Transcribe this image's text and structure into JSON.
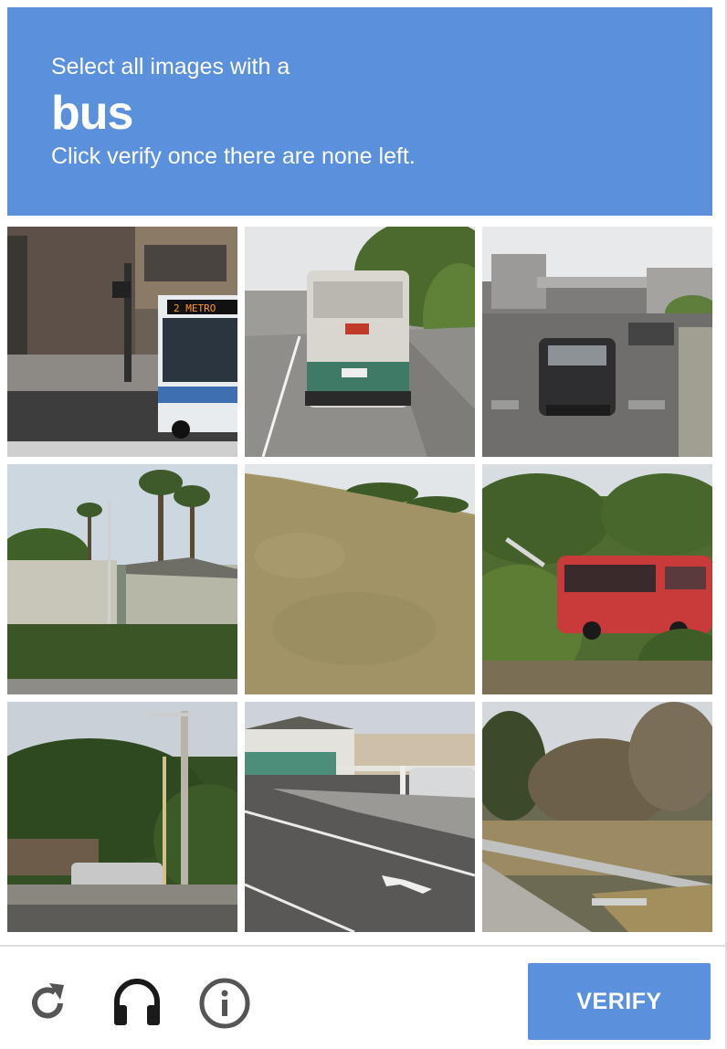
{
  "header": {
    "instruction_line1": "Select all images with a",
    "keyword": "bus",
    "instruction_line3": "Click verify once there are none left."
  },
  "grid": {
    "tiles": [
      {
        "name": "tile-1",
        "depicts": "city bus at intersection"
      },
      {
        "name": "tile-2",
        "depicts": "bus rear on road"
      },
      {
        "name": "tile-3",
        "depicts": "street with SUV"
      },
      {
        "name": "tile-4",
        "depicts": "palm trees and house"
      },
      {
        "name": "tile-5",
        "depicts": "grassy hill"
      },
      {
        "name": "tile-6",
        "depicts": "red bus among trees"
      },
      {
        "name": "tile-7",
        "depicts": "power pole and trees"
      },
      {
        "name": "tile-8",
        "depicts": "parking lot"
      },
      {
        "name": "tile-9",
        "depicts": "guard rail and trees"
      }
    ],
    "tile_text": {
      "bus_sign": "2 METRO"
    }
  },
  "footer": {
    "reload_icon": "reload-icon",
    "audio_icon": "headphones-icon",
    "info_icon": "info-icon",
    "verify_label": "VERIFY"
  },
  "colors": {
    "accent": "#5a90dc",
    "divider": "#dedede",
    "icon": "#555555"
  }
}
